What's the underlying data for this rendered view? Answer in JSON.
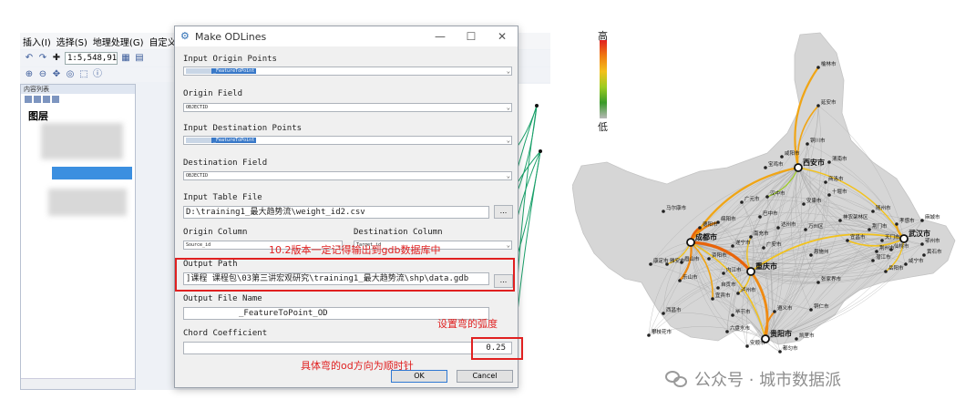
{
  "arcmap": {
    "menu": [
      "插入(I)",
      "选择(S)",
      "地理处理(G)",
      "自定义(C"
    ],
    "scale": "1:5,548,91",
    "toc_title": "内容列表",
    "layers_label": "图层"
  },
  "dialog": {
    "title": "Make ODLines",
    "input_origin_points_label": "Input Origin Points",
    "input_origin_points_value": "_FeatureToPoint",
    "origin_field_label": "Origin Field",
    "origin_field_value": "OBJECTID",
    "input_destination_points_label": "Input Destination Points",
    "input_destination_points_value": "_FeatureToPoint",
    "destination_field_label": "Destination Field",
    "destination_field_value": "OBJECTID",
    "input_table_file_label": "Input Table File",
    "input_table_file_value": "D:\\training1_最大趋势流\\weight_id2.csv",
    "origin_column_label": "Origin Column",
    "origin_column_value": "Source_id",
    "destination_column_label": "Destination Column",
    "destination_column_value": "Target_id",
    "output_path_label": "Output Path",
    "output_path_value": "]课程      课程包\\03第三讲宏观研究\\training1_最大趋势流\\shp\\data.gdb",
    "output_file_name_label": "Output File Name",
    "output_file_name_value": "_FeatureToPoint_OD",
    "chord_coefficient_label": "Chord Coefficient",
    "chord_coefficient_value": "0.25",
    "ok_label": "OK",
    "cancel_label": "Cancel",
    "browse_label": "...",
    "window_controls": [
      "—",
      "☐",
      "✕"
    ]
  },
  "annotations": {
    "gdb_note": "10.2版本一定记得输出到gdb数据库中",
    "arc_note": "设置弯的弧度",
    "direction_note": "具体弯的od方向为顺时针"
  },
  "map": {
    "legend_high": "高",
    "legend_low": "低",
    "cities": [
      "榆林市",
      "延安市",
      "铜川市",
      "咸阳市",
      "西安市",
      "渭南市",
      "宝鸡市",
      "商洛市",
      "汉中市",
      "安康市",
      "十堰市",
      "广元市",
      "巴中市",
      "达州市",
      "绵阳市",
      "德阳市",
      "成都市",
      "资阳市",
      "遂宁市",
      "南充市",
      "广安市",
      "眉山市",
      "乐山市",
      "内江市",
      "自贡市",
      "宜宾市",
      "泸州市",
      "重庆市",
      "万州区",
      "神农架林区",
      "宜昌市",
      "荆门市",
      "荆州市",
      "孝感市",
      "武汉市",
      "鄂州市",
      "黄石市",
      "咸宁市",
      "仙桃市",
      "天门市",
      "潜江市",
      "岳阳市",
      "恩施州",
      "张家界市",
      "遵义市",
      "贵阳市",
      "安顺市",
      "都匀市",
      "凯里市",
      "六盘水市",
      "毕节市",
      "雅安市",
      "西昌市",
      "攀枝花市",
      "马尔康市",
      "康定市",
      "铜仁市",
      "随州市",
      "麻城市",
      "六盘水市"
    ],
    "major_cities": [
      "西安市",
      "成都市",
      "重庆市",
      "武汉市",
      "贵阳市"
    ]
  },
  "watermark": "公众号 · 城市数据派",
  "colors": {
    "annotation_red": "#e02020",
    "flow_high": "#e65c00",
    "flow_mid": "#f2b21c",
    "flow_low": "#bdbdbd",
    "flow_green": "#1aa06a"
  }
}
